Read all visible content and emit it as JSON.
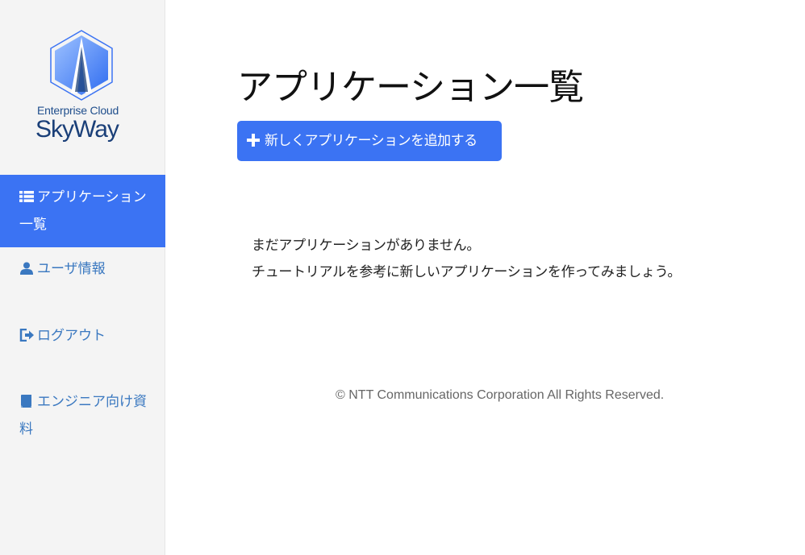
{
  "sidebar": {
    "logo": {
      "subtitle": "Enterprise Cloud",
      "title": "SkyWay"
    },
    "items": [
      {
        "label": "アプリケーション一覧",
        "icon": "list-icon",
        "active": true
      },
      {
        "label": "ユーザ情報",
        "icon": "user-icon",
        "active": false
      },
      {
        "label": "ログアウト",
        "icon": "sign-out-icon",
        "active": false
      },
      {
        "label": "エンジニア向け資料",
        "icon": "book-icon",
        "active": false
      }
    ]
  },
  "main": {
    "title": "アプリケーション一覧",
    "add_button_label": "新しくアプリケーションを追加する",
    "empty_message": {
      "line1": "まだアプリケーションがありません。",
      "line2": "チュートリアルを参考に新しいアプリケーションを作ってみましょう。"
    }
  },
  "footer": {
    "copyright": "© NTT Communications Corporation All Rights Reserved."
  },
  "colors": {
    "accent": "#3b73f3",
    "link": "#3a78c0",
    "sidebar_bg": "#f4f4f4",
    "logo_text": "#1a3f78"
  }
}
